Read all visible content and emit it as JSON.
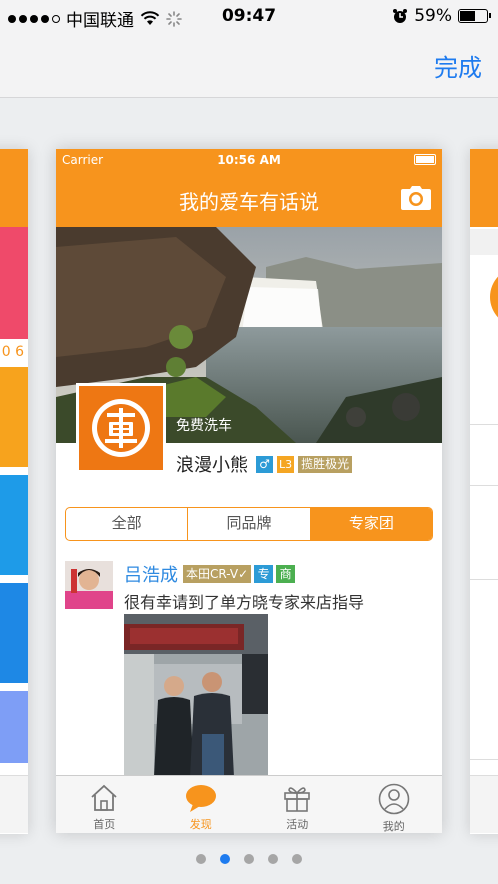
{
  "os_status": {
    "carrier": "中国联通",
    "time": "09:47",
    "battery": "59%",
    "battery_level": 0.59
  },
  "top_bar": {
    "done_label": "完成"
  },
  "app": {
    "status": {
      "carrier": "Carrier",
      "time": "10:56 AM"
    },
    "title": "我的爱车有话说",
    "profile": {
      "avatar_label": "免费洗车",
      "username": "浪漫小熊",
      "gender": "♂",
      "level": "L3",
      "car": "揽胜极光"
    },
    "segments": [
      {
        "label": "全部",
        "active": false
      },
      {
        "label": "同品牌",
        "active": false
      },
      {
        "label": "专家团",
        "active": true
      }
    ],
    "post": {
      "name": "吕浩成",
      "car": "本田CR-V",
      "tag1": "专",
      "tag2": "商",
      "text": "很有幸请到了单方晓专家来店指导"
    },
    "tabs": [
      {
        "label": "首页",
        "icon": "home-icon",
        "active": false
      },
      {
        "label": "发现",
        "icon": "chat-bubble-icon",
        "active": true
      },
      {
        "label": "活动",
        "icon": "gift-icon",
        "active": false
      },
      {
        "label": "我的",
        "icon": "user-icon",
        "active": false
      }
    ]
  },
  "side_cards": {
    "left_text": "0 6"
  },
  "pager": {
    "count": 5,
    "active": 1
  },
  "colors": {
    "accent_orange": "#f7941d",
    "ios_blue": "#1e7bef"
  }
}
